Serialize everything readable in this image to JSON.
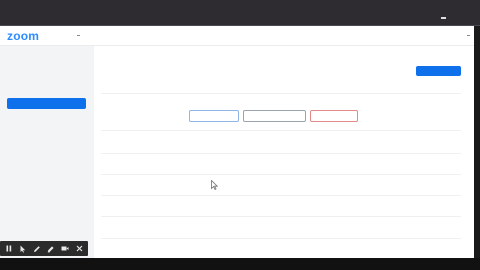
{
  "app": {
    "logo_text": "zoom"
  },
  "colors": {
    "brand": "#2d8cff",
    "primary_button": "#0e71eb",
    "outline_blue": "#8fb6e6",
    "outline_red": "#e58a8a"
  },
  "icons": {
    "toolbar": [
      "pause-icon",
      "pointer-icon",
      "pen-icon",
      "marker-icon",
      "camera-icon",
      "close-icon"
    ]
  }
}
